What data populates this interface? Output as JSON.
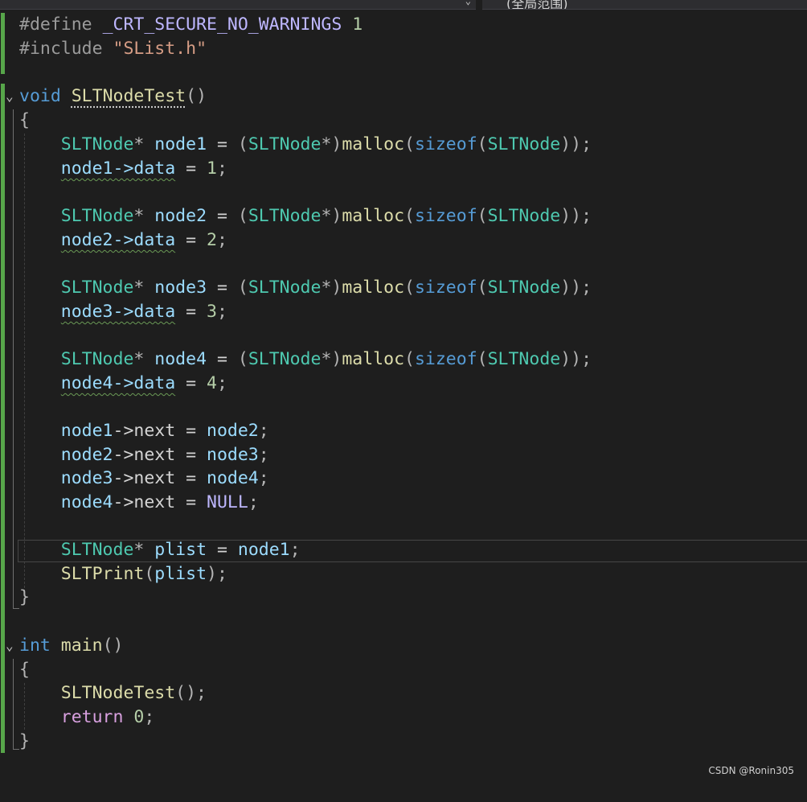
{
  "toolbar": {
    "scope_label": "(全局范围)"
  },
  "code": {
    "line1": {
      "pp": "#define",
      "macro": "_CRT_SECURE_NO_WARNINGS",
      "num": "1"
    },
    "line2": {
      "pp": "#include",
      "str": "\"SList.h\""
    },
    "func1": {
      "kw": "void",
      "name": "SLTNodeTest",
      "parens": "()"
    },
    "open_brace": "{",
    "close_brace": "}",
    "decl_type": "SLTNode",
    "star": "*",
    "malloc": "malloc",
    "sizeof": "sizeof",
    "nodes": [
      {
        "name": "node1",
        "data_expr": "node1->data",
        "value": "1",
        "next_target": "node2"
      },
      {
        "name": "node2",
        "data_expr": "node2->data",
        "value": "2",
        "next_target": "node3"
      },
      {
        "name": "node3",
        "data_expr": "node3->data",
        "value": "3",
        "next_target": "node4"
      },
      {
        "name": "node4",
        "data_expr": "node4->data",
        "value": "4",
        "next_target": "NULL"
      }
    ],
    "next_field": "->next",
    "plist_var": "plist",
    "plist_init": "node1",
    "print_fn": "SLTPrint",
    "print_arg": "plist",
    "func2": {
      "kw": "int",
      "name": "main",
      "parens": "()"
    },
    "call": "SLTNodeTest",
    "return_kw": "return",
    "return_val": "0"
  },
  "watermark": "CSDN @Ronin305",
  "colors": {
    "background": "#1e1e1e",
    "keyword": "#569cd6",
    "type": "#4ec9b0",
    "function": "#dcdcaa",
    "variable": "#9cdcfe",
    "string": "#d69d85",
    "change_bar": "#57a64a"
  }
}
